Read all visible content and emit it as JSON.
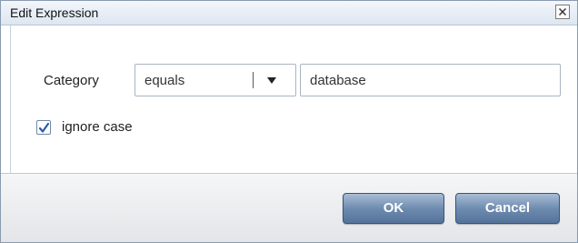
{
  "dialog": {
    "title": "Edit Expression",
    "close_icon": "close-icon"
  },
  "form": {
    "category_label": "Category",
    "operator": {
      "selected": "equals",
      "arrow_icon": "dropdown-arrow-icon"
    },
    "value": "database",
    "ignore_case": {
      "label": "ignore case",
      "checked": true
    }
  },
  "footer": {
    "ok_label": "OK",
    "cancel_label": "Cancel"
  },
  "colors": {
    "button_gradient_top": "#a9bdd5",
    "button_gradient_bottom": "#55739a",
    "checkmark": "#2a5fa8",
    "titlebar": "#dde6f1"
  }
}
